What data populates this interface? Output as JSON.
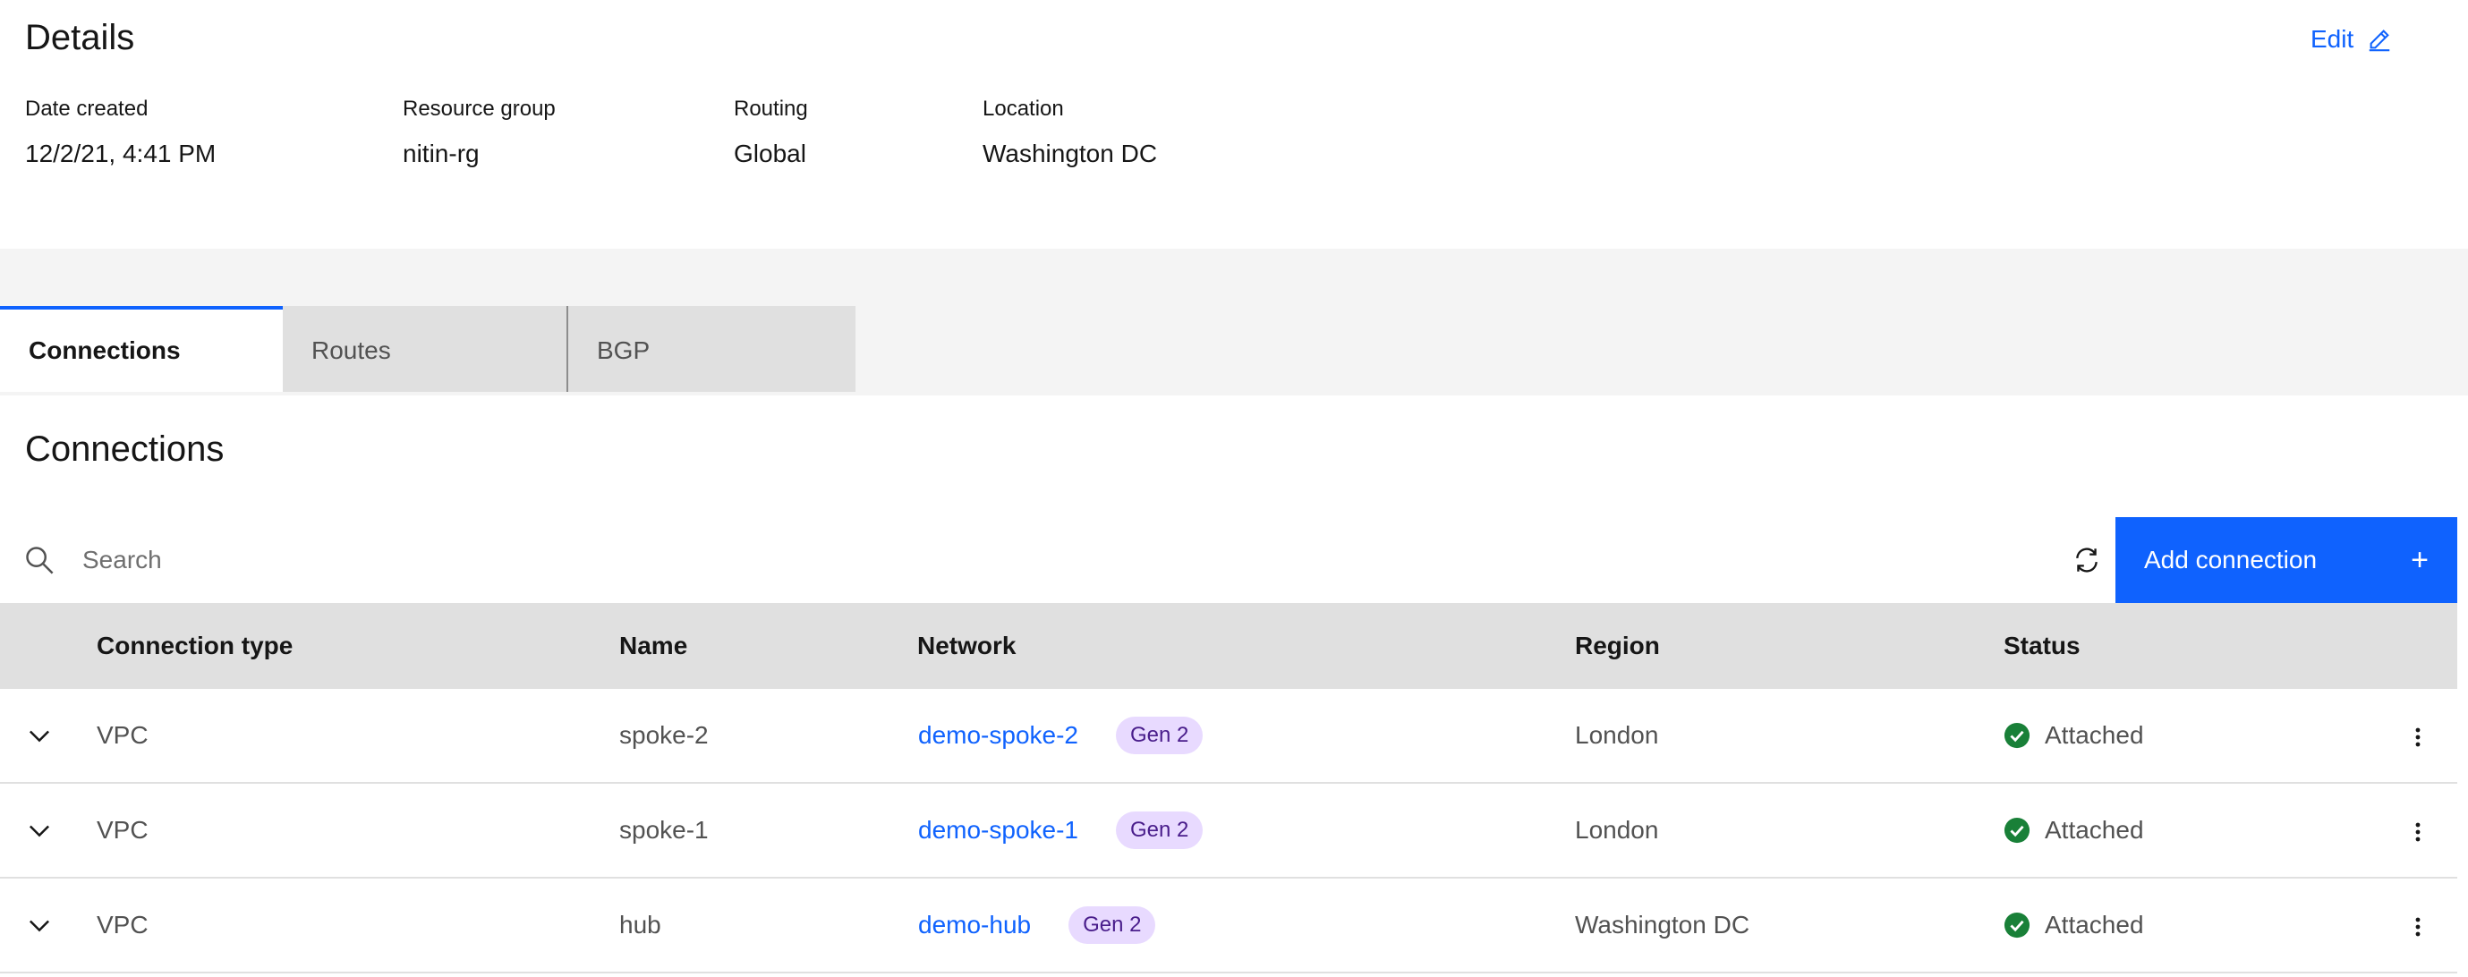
{
  "details": {
    "title": "Details",
    "edit_label": "Edit",
    "fields": [
      {
        "label": "Date created",
        "value": "12/2/21, 4:41 PM"
      },
      {
        "label": "Resource group",
        "value": "nitin-rg"
      },
      {
        "label": "Routing",
        "value": "Global"
      },
      {
        "label": "Location",
        "value": "Washington DC"
      }
    ]
  },
  "tabs": [
    {
      "label": "Connections",
      "active": true
    },
    {
      "label": "Routes",
      "active": false
    },
    {
      "label": "BGP",
      "active": false
    }
  ],
  "connections": {
    "title": "Connections",
    "search": {
      "placeholder": "Search",
      "value": ""
    },
    "refresh_icon": "refresh-icon",
    "add_button_label": "Add connection",
    "add_button_icon": "+",
    "columns": [
      "Connection type",
      "Name",
      "Network",
      "Region",
      "Status"
    ],
    "rows": [
      {
        "type": "VPC",
        "name": "spoke-2",
        "network": "demo-spoke-2",
        "tag": "Gen 2",
        "region": "London",
        "status": "Attached"
      },
      {
        "type": "VPC",
        "name": "spoke-1",
        "network": "demo-spoke-1",
        "tag": "Gen 2",
        "region": "London",
        "status": "Attached"
      },
      {
        "type": "VPC",
        "name": "hub",
        "network": "demo-hub",
        "tag": "Gen 2",
        "region": "Washington DC",
        "status": "Attached"
      }
    ]
  },
  "colors": {
    "accent": "#0f62fe",
    "status_success": "#198038",
    "tag_bg": "#e8daff",
    "tag_text": "#491d8b",
    "header_bg": "#e0e0e0",
    "band_bg": "#f4f4f4"
  }
}
